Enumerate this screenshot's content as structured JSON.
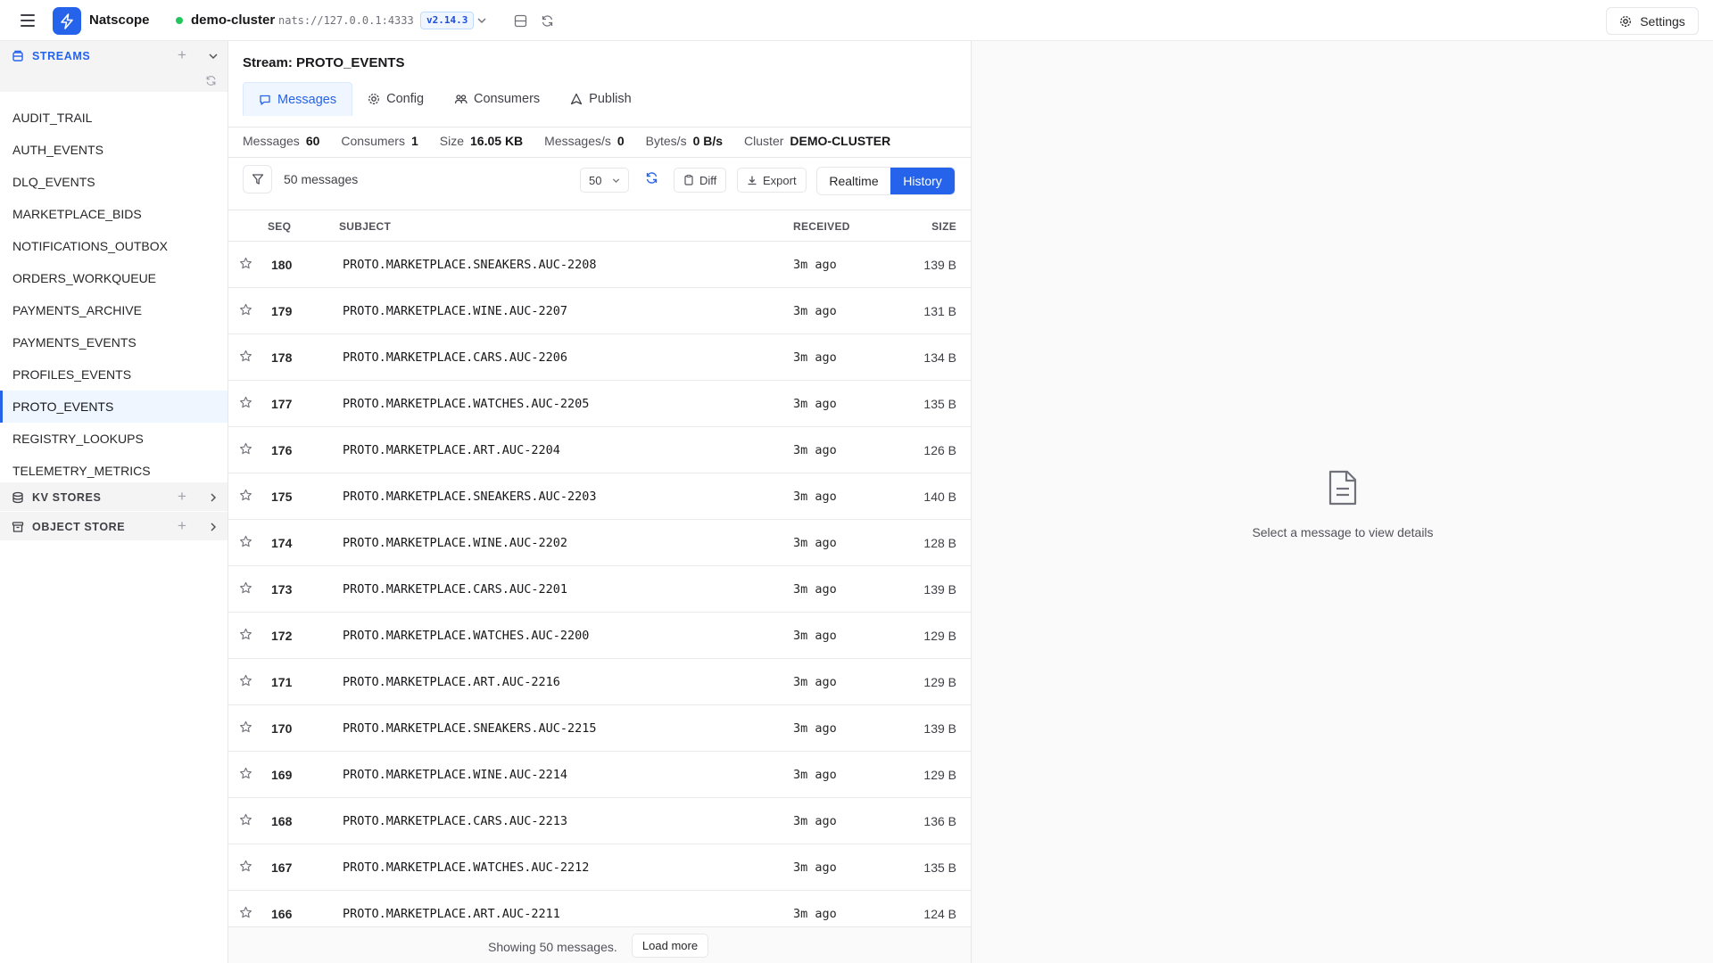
{
  "app": {
    "name": "Natscope",
    "cluster_name": "demo-cluster",
    "cluster_url": "nats://127.0.0.1:4333",
    "version": "v2.14.3",
    "settings_label": "Settings",
    "brand_color": "#2563eb",
    "status_color": "#22c55e"
  },
  "sidebar": {
    "streams_label": "STREAMS",
    "kv_label": "KV STORES",
    "object_label": "OBJECT STORE",
    "streams": [
      {
        "label": "AUDIT_TRAIL"
      },
      {
        "label": "AUTH_EVENTS"
      },
      {
        "label": "DLQ_EVENTS"
      },
      {
        "label": "MARKETPLACE_BIDS"
      },
      {
        "label": "NOTIFICATIONS_OUTBOX"
      },
      {
        "label": "ORDERS_WORKQUEUE"
      },
      {
        "label": "PAYMENTS_ARCHIVE"
      },
      {
        "label": "PAYMENTS_EVENTS"
      },
      {
        "label": "PROFILES_EVENTS"
      },
      {
        "label": "PROTO_EVENTS"
      },
      {
        "label": "REGISTRY_LOOKUPS"
      },
      {
        "label": "TELEMETRY_METRICS"
      }
    ],
    "active_stream": "PROTO_EVENTS"
  },
  "main": {
    "title": "Stream: PROTO_EVENTS",
    "tabs": [
      {
        "label": "Messages",
        "icon": "message-icon"
      },
      {
        "label": "Config",
        "icon": "gear-icon"
      },
      {
        "label": "Consumers",
        "icon": "users-icon"
      },
      {
        "label": "Publish",
        "icon": "send-icon"
      }
    ],
    "stats": [
      {
        "key": "Messages",
        "value": "60"
      },
      {
        "key": "Consumers",
        "value": "1"
      },
      {
        "key": "Size",
        "value": "16.05 KB"
      },
      {
        "key": "Messages/s",
        "value": "0"
      },
      {
        "key": "Bytes/s",
        "value": "0 B/s"
      },
      {
        "key": "Cluster",
        "value": "DEMO-CLUSTER"
      }
    ],
    "toolbar": {
      "message_count": "50 messages",
      "limit": "50",
      "diff_label": "Diff",
      "export_label": "Export",
      "realtime_label": "Realtime",
      "history_label": "History"
    },
    "columns": {
      "seq": "SEQ",
      "subject": "SUBJECT",
      "received": "RECEIVED",
      "size": "SIZE"
    },
    "rows": [
      {
        "seq": "180",
        "subject": "PROTO.MARKETPLACE.SNEAKERS.AUC-2208",
        "received": "3m ago",
        "size": "139 B"
      },
      {
        "seq": "179",
        "subject": "PROTO.MARKETPLACE.WINE.AUC-2207",
        "received": "3m ago",
        "size": "131 B"
      },
      {
        "seq": "178",
        "subject": "PROTO.MARKETPLACE.CARS.AUC-2206",
        "received": "3m ago",
        "size": "134 B"
      },
      {
        "seq": "177",
        "subject": "PROTO.MARKETPLACE.WATCHES.AUC-2205",
        "received": "3m ago",
        "size": "135 B"
      },
      {
        "seq": "176",
        "subject": "PROTO.MARKETPLACE.ART.AUC-2204",
        "received": "3m ago",
        "size": "126 B"
      },
      {
        "seq": "175",
        "subject": "PROTO.MARKETPLACE.SNEAKERS.AUC-2203",
        "received": "3m ago",
        "size": "140 B"
      },
      {
        "seq": "174",
        "subject": "PROTO.MARKETPLACE.WINE.AUC-2202",
        "received": "3m ago",
        "size": "128 B"
      },
      {
        "seq": "173",
        "subject": "PROTO.MARKETPLACE.CARS.AUC-2201",
        "received": "3m ago",
        "size": "139 B"
      },
      {
        "seq": "172",
        "subject": "PROTO.MARKETPLACE.WATCHES.AUC-2200",
        "received": "3m ago",
        "size": "129 B"
      },
      {
        "seq": "171",
        "subject": "PROTO.MARKETPLACE.ART.AUC-2216",
        "received": "3m ago",
        "size": "129 B"
      },
      {
        "seq": "170",
        "subject": "PROTO.MARKETPLACE.SNEAKERS.AUC-2215",
        "received": "3m ago",
        "size": "139 B"
      },
      {
        "seq": "169",
        "subject": "PROTO.MARKETPLACE.WINE.AUC-2214",
        "received": "3m ago",
        "size": "129 B"
      },
      {
        "seq": "168",
        "subject": "PROTO.MARKETPLACE.CARS.AUC-2213",
        "received": "3m ago",
        "size": "136 B"
      },
      {
        "seq": "167",
        "subject": "PROTO.MARKETPLACE.WATCHES.AUC-2212",
        "received": "3m ago",
        "size": "135 B"
      },
      {
        "seq": "166",
        "subject": "PROTO.MARKETPLACE.ART.AUC-2211",
        "received": "3m ago",
        "size": "124 B"
      }
    ],
    "footer": {
      "showing": "Showing 50 messages.",
      "load_more": "Load more"
    }
  },
  "detail": {
    "empty_text": "Select a message to view details",
    "empty_icon": "file-icon"
  }
}
